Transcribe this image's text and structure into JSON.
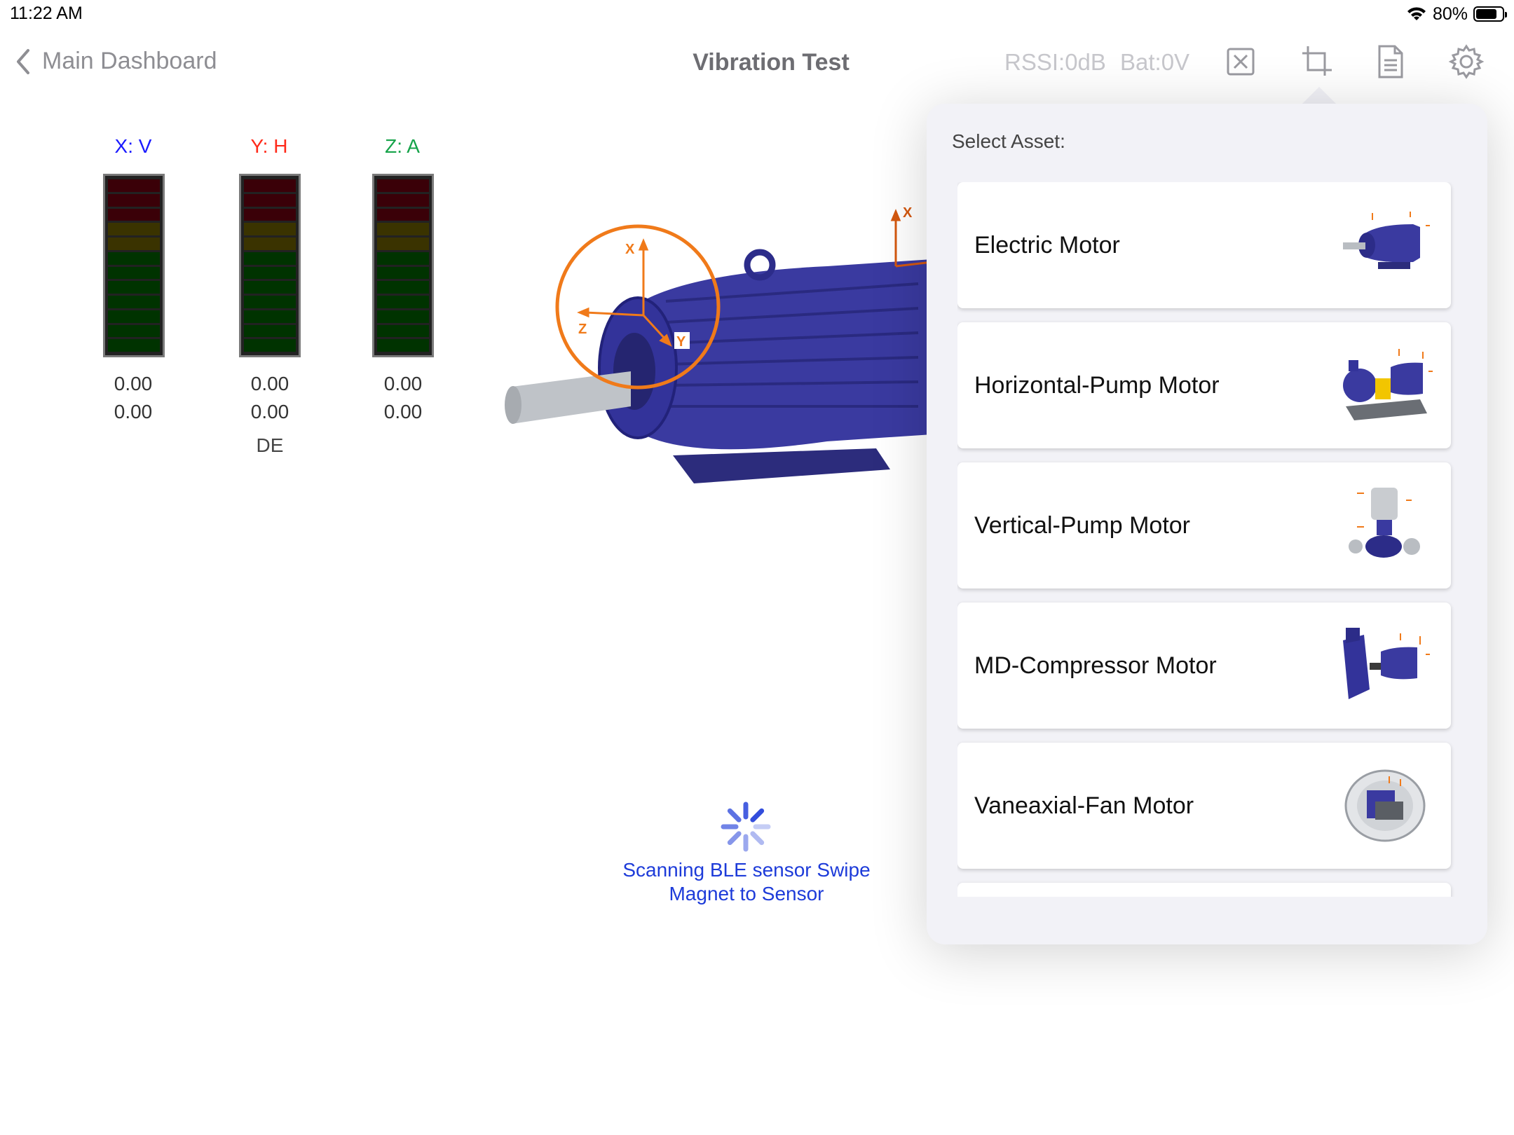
{
  "status_bar": {
    "time": "11:22 AM",
    "battery_percent": "80%",
    "battery_level": 0.8
  },
  "nav": {
    "back_label": "Main Dashboard",
    "title": "Vibration Test",
    "rssi": "RSSI:0dB",
    "bat": "Bat:0V",
    "icons": [
      "close-box-icon",
      "crop-icon",
      "document-icon",
      "gear-icon"
    ]
  },
  "gauges": {
    "x": {
      "label": "X: V",
      "color": "#1a1aff",
      "value1": "0.00",
      "value2": "0.00"
    },
    "y": {
      "label": "Y: H",
      "color": "#ff2a1a",
      "value1": "0.00",
      "value2": "0.00"
    },
    "z": {
      "label": "Z: A",
      "color": "#16a34a",
      "value1": "0.00",
      "value2": "0.00"
    },
    "location": "DE"
  },
  "motor": {
    "axis_x": "X",
    "axis_y": "Y",
    "axis_z": "Z",
    "accent": "#f07a1a",
    "body_color": "#3a3a9a"
  },
  "scanning": {
    "text": "Scanning BLE sensor Swipe Magnet to Sensor",
    "color": "#1d3bd9"
  },
  "asset_popover": {
    "title": "Select Asset:",
    "items": [
      {
        "label": "Electric Motor",
        "icon": "electric-motor-thumbnail"
      },
      {
        "label": "Horizontal-Pump Motor",
        "icon": "horizontal-pump-thumbnail"
      },
      {
        "label": "Vertical-Pump Motor",
        "icon": "vertical-pump-thumbnail"
      },
      {
        "label": "MD-Compressor Motor",
        "icon": "compressor-thumbnail"
      },
      {
        "label": "Vaneaxial-Fan Motor",
        "icon": "fan-thumbnail"
      }
    ]
  }
}
